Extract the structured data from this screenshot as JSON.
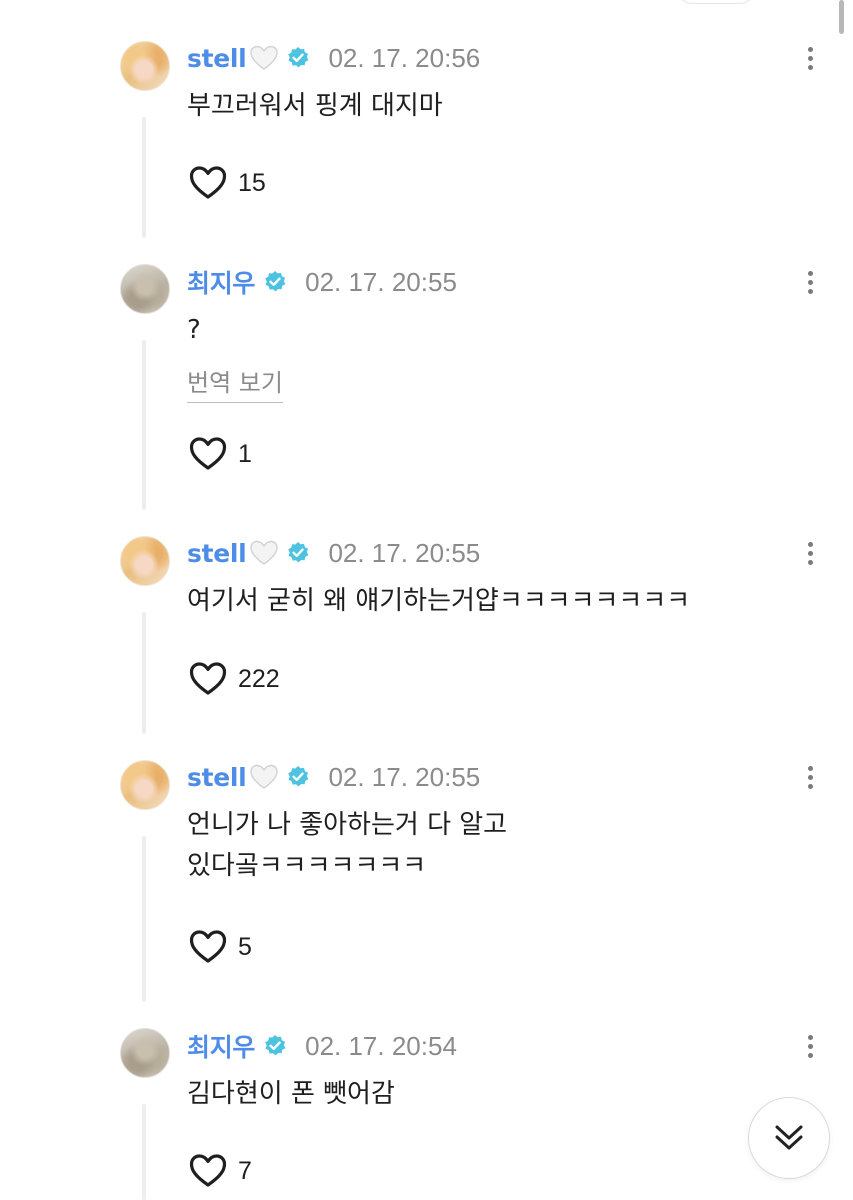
{
  "comments": [
    {
      "author": "stell",
      "author_has_white_heart": true,
      "verified": true,
      "timestamp": "02. 17. 20:56",
      "text": "부끄러워서 핑계 대지마",
      "likes": "15",
      "avatar": "stell-avatar"
    },
    {
      "author": "최지우",
      "author_has_white_heart": false,
      "verified": true,
      "timestamp": "02. 17. 20:55",
      "text": "?",
      "translate_label": "번역 보기",
      "likes": "1",
      "avatar": "jiwoo-avatar"
    },
    {
      "author": "stell",
      "author_has_white_heart": true,
      "verified": true,
      "timestamp": "02. 17. 20:55",
      "text": "여기서 굳히 왜 얘기하는거얍ㅋㅋㅋㅋㅋㅋㅋㅋ",
      "likes": "222",
      "avatar": "stell-avatar"
    },
    {
      "author": "stell",
      "author_has_white_heart": true,
      "verified": true,
      "timestamp": "02. 17. 20:55",
      "text": "언니가 나 좋아하는거 다 알고\n있다곸ㅋㅋㅋㅋㅋㅋㅋ",
      "likes": "5",
      "avatar": "stell-avatar"
    },
    {
      "author": "최지우",
      "author_has_white_heart": false,
      "verified": true,
      "timestamp": "02. 17. 20:54",
      "text": "김다현이 폰 뺏어감",
      "likes": "7",
      "avatar": "jiwoo-avatar"
    }
  ],
  "icons": {
    "verified": "verified-badge-icon",
    "white_heart": "white-heart-emoji",
    "like": "heart-outline-icon",
    "more": "more-vertical-icon",
    "scroll_down": "double-chevron-down-icon"
  },
  "colors": {
    "username": "#4d8de8",
    "verified_badge": "#4cc3e0",
    "timestamp": "#8b8b8b",
    "text": "#1f1f1f"
  }
}
